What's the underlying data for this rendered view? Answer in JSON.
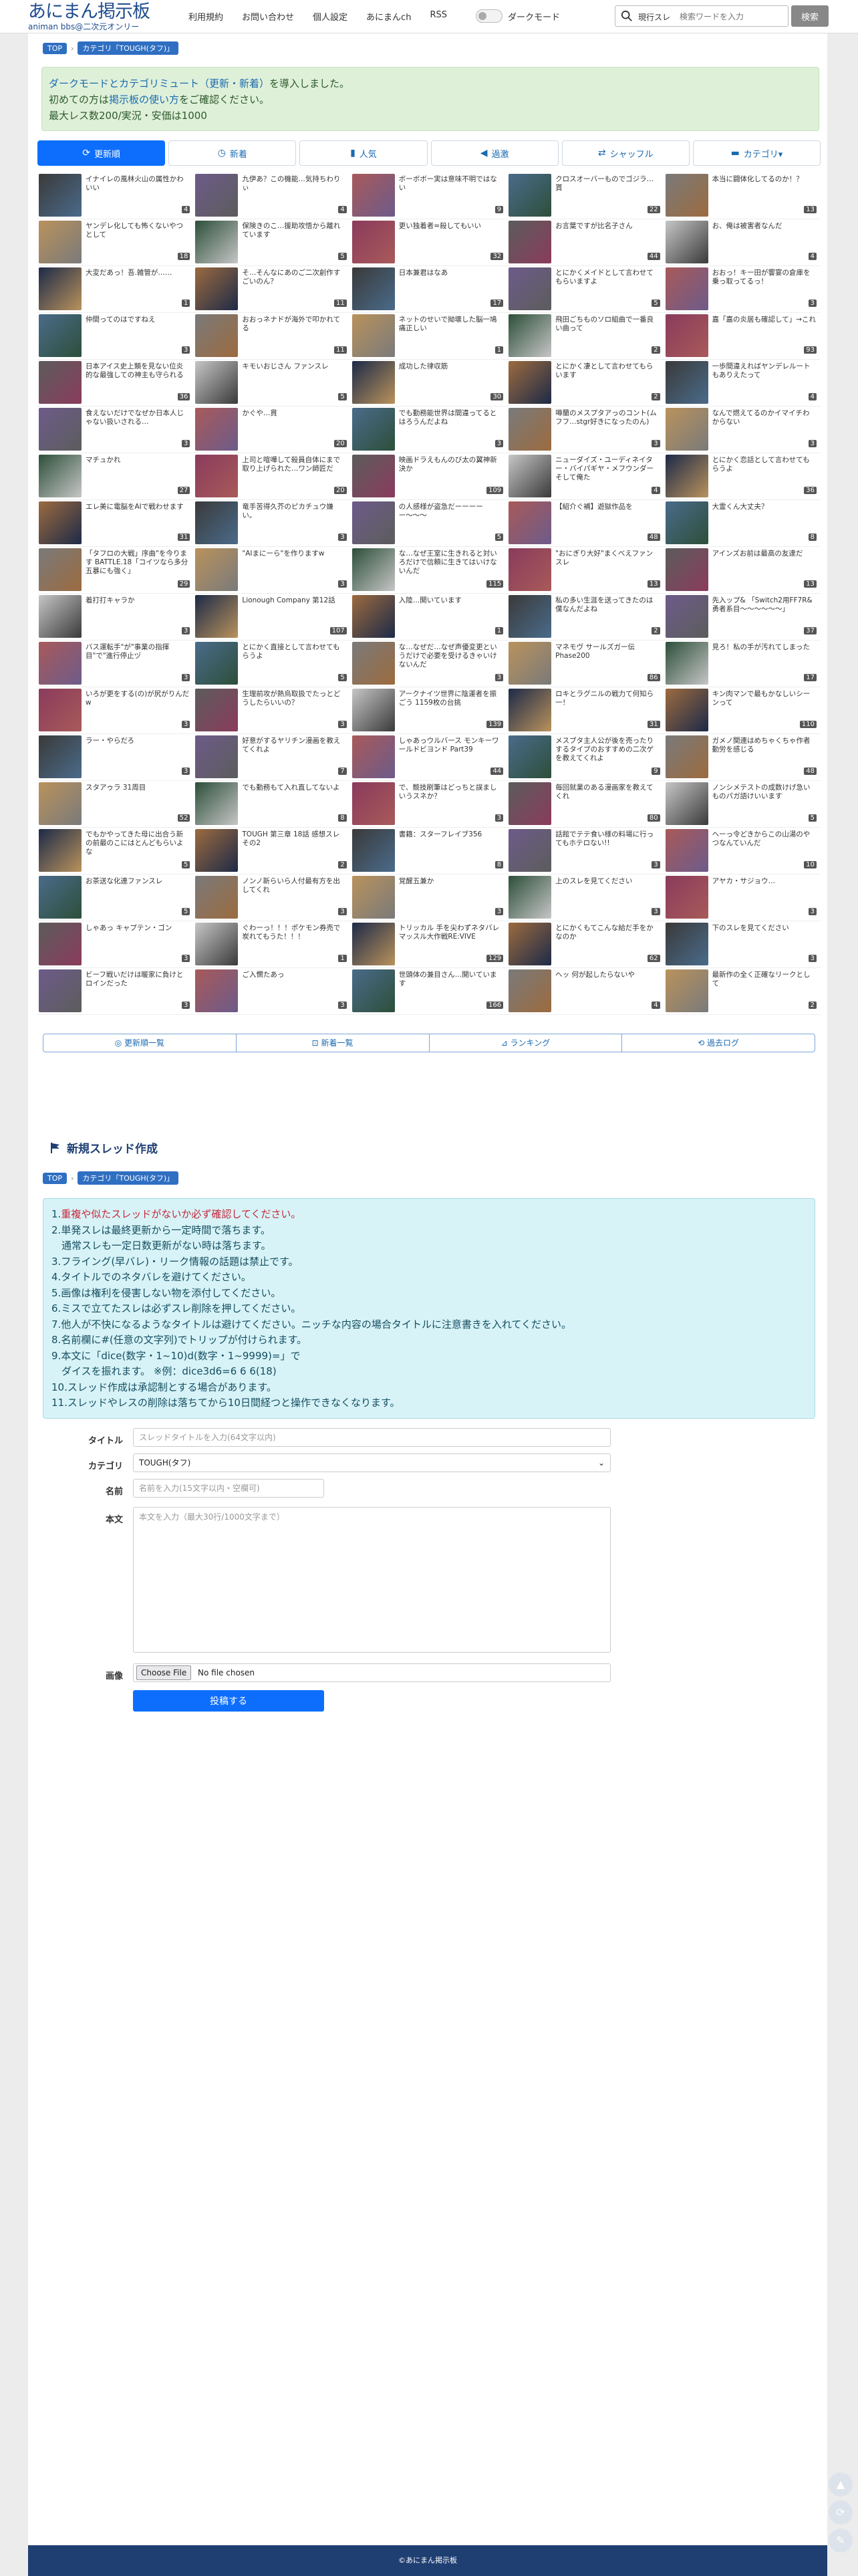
{
  "header": {
    "logo_main": "あにまん掲示板",
    "logo_sub": "animan bbs@二次元オンリー",
    "nav": [
      "利用規約",
      "お問い合わせ",
      "個人設定",
      "あにまんch",
      "RSS"
    ],
    "dark_mode_label": "ダークモード",
    "search_scope": "現行スレ",
    "search_placeholder": "検索ワードを入力",
    "search_button": "検索"
  },
  "breadcrumb": {
    "top": "TOP",
    "category": "カテゴリ「TOUGH(タフ)」"
  },
  "notice": {
    "line1_link": "ダークモードとカテゴリミュート（更新・新着）",
    "line1_rest": "を導入しました。",
    "line2_prefix": "初めての方は",
    "line2_link": "掲示板の使い方",
    "line2_rest": "をご確認ください。",
    "line3": "最大レス数200/実況・安価は1000"
  },
  "tabs": [
    {
      "label": "更新順",
      "icon": "refresh-icon"
    },
    {
      "label": "新着",
      "icon": "clock-icon"
    },
    {
      "label": "人気",
      "icon": "bar-chart-icon"
    },
    {
      "label": "過激",
      "icon": "volume-icon"
    },
    {
      "label": "シャッフル",
      "icon": "shuffle-icon"
    },
    {
      "label": "カテゴリ▾",
      "icon": "folder-icon"
    }
  ],
  "threads": [
    {
      "t": "イナイレの風林火山の属性かわいい",
      "c": "4"
    },
    {
      "t": "九伊あ？この機能…気持ちわりぃ",
      "c": "4"
    },
    {
      "t": "ボーボボー実は意味不明ではない",
      "c": "9"
    },
    {
      "t": "クロスオーバーものでゴジラ…貰",
      "c": "22"
    },
    {
      "t": "本当に闘体化してるのか！？",
      "c": "13"
    },
    {
      "t": "ヤンデレ化しても怖くないやつとして",
      "c": "18"
    },
    {
      "t": "保険きのこ…援助攻悟から離れています",
      "c": "5"
    },
    {
      "t": "更い独着者=殺してもいい",
      "c": "32"
    },
    {
      "t": "お言葉ですが比名子さん",
      "c": "44"
    },
    {
      "t": "お、俺は被害者なんだ",
      "c": "4"
    },
    {
      "t": "大変だあっ！吾.雑管が……",
      "c": "1"
    },
    {
      "t": "そ…そんなにあのご二次創作すごいのん？",
      "c": "11"
    },
    {
      "t": "日本兼君はなあ",
      "c": "17"
    },
    {
      "t": "とにかくメイドとして言わせてもらいますよ",
      "c": "5"
    },
    {
      "t": "おおっ！キー田が饗宴の倉庫を乗っ取ってるっ！",
      "c": "3"
    },
    {
      "t": "仲間ってのはですねえ",
      "c": "3"
    },
    {
      "t": "おおっネナドが海外で叩かれてる",
      "c": "11"
    },
    {
      "t": "ネットのせいで拗壊した脳一鳩痛正しい",
      "c": "1"
    },
    {
      "t": "飛田ごちものソロ組曲で一番良い曲って",
      "c": "2"
    },
    {
      "t": "嘉「嘉の炎居も確認して」→これ",
      "c": "93"
    },
    {
      "t": "日本アイス史上類を見ない位炎的な最強しての神主も守られる",
      "c": "36"
    },
    {
      "t": "キモいおじさん ファンスレ",
      "c": "5"
    },
    {
      "t": "成功した律収筋",
      "c": "30"
    },
    {
      "t": "とにかく凄として言わせてもらいます",
      "c": "2"
    },
    {
      "t": "一歩間違えればヤンデレルートもありえたって",
      "c": "4"
    },
    {
      "t": "食えないだけでなぜか日本人じゃない扱いされる…",
      "c": "3"
    },
    {
      "t": "かぐや…貫",
      "c": "20"
    },
    {
      "t": "でも勤務能世界は間違ってるとはろうんだよね",
      "c": "3"
    },
    {
      "t": "噂蘭のメスプタアっのコント(ムフフ…stgr好きになったのん)",
      "c": "3"
    },
    {
      "t": "なんで燃えてるのかイマイチわからない",
      "c": "3"
    },
    {
      "t": "マチュかれ",
      "c": "27"
    },
    {
      "t": "上司と喧嘩して殺員自体にまで取り上げられた…ワン師匠だ",
      "c": "20"
    },
    {
      "t": "映画ドラえもんのび太の翼神新決か",
      "c": "109"
    },
    {
      "t": "ニューダイズ・ユーディネイター・バイパギヤ・メフウンダーそして俺た",
      "c": "4"
    },
    {
      "t": "とにかく恋話として言わせてもらうよ",
      "c": "36"
    },
    {
      "t": "エレ美に電脳をAIで戦わせます",
      "c": "31"
    },
    {
      "t": "竜手苦得久芥のピカチュウ嫌い。",
      "c": "3"
    },
    {
      "t": "の人感様が盗急だーーーーー〜〜〜",
      "c": "5"
    },
    {
      "t": "【紹介ぐ補】遊獄作品を",
      "c": "48"
    },
    {
      "t": "大霊くん大丈夫？",
      "c": "8"
    },
    {
      "t": "「タフロの大戦」序曲\"を今ります BATTLE.18「コイツなら多分五暴にも強く」",
      "c": "29"
    },
    {
      "t": "\"AIまにーら\"を作りますw",
      "c": "3"
    },
    {
      "t": "な…なぜ王室に生きれると対いろだけで信頼に生きてはいけないんだ",
      "c": "115"
    },
    {
      "t": "\"おにぎり大好\"まくべえファンスレ",
      "c": "13"
    },
    {
      "t": "アインズお前は最高の友達だ",
      "c": "13"
    },
    {
      "t": "着打打キャラか",
      "c": "3"
    },
    {
      "t": "Lionough Company 第12話",
      "c": "107"
    },
    {
      "t": "入陸…開いています",
      "c": "1"
    },
    {
      "t": "私の多い生涯を送ってきたのは僕なんだよね",
      "c": "2"
    },
    {
      "t": "先入ップ& 「Switch2用FF7R&勇者系目〜〜〜〜〜〜」",
      "c": "37"
    },
    {
      "t": "バス運転手\"が\"事業の指揮目\"で\"進行停止ヅ",
      "c": "3"
    },
    {
      "t": "とにかく直接として言わせてもらうよ",
      "c": "5"
    },
    {
      "t": "な…なぜだ…なぜ声優変更というだけで必要を受けるきゃいけないんだ",
      "c": "3"
    },
    {
      "t": "マネモヴ サールズガー伝Phase200",
      "c": "86"
    },
    {
      "t": "見ろ！私の手が汚れてしまった",
      "c": "17"
    },
    {
      "t": "いろが更をする(の)が尻がりんだw",
      "c": "3"
    },
    {
      "t": "生理前攻が熱烏取扱でたっとどうしたらいいの？",
      "c": "3"
    },
    {
      "t": "アークナイツ世界に陰運者を振ごう 1159枚の台挑",
      "c": "139"
    },
    {
      "t": "ロキとラグニルの戦力て何知ら一！",
      "c": "31"
    },
    {
      "t": "キン肉マンで最もかなしいシーンって",
      "c": "110"
    },
    {
      "t": "ラー・やらだろ",
      "c": "3"
    },
    {
      "t": "好意がするヤリチン漫画を教えてくれよ",
      "c": "7"
    },
    {
      "t": "しゃあっウルバース モンキーワールドビヨンド Part39",
      "c": "44"
    },
    {
      "t": "メスブタ主人公が後を売ったりするタイプのおすすめの二次ゲを教えてくれよ",
      "c": "9"
    },
    {
      "t": "ガメノ関連はめちゃくちゃ作者勤労を感じる",
      "c": "48"
    },
    {
      "t": "スタアゥラ 31周目",
      "c": "52"
    },
    {
      "t": "でも勤務もて入れ直してないよ",
      "c": "8"
    },
    {
      "t": "で、競技刷筆はどっちと誤ましいうスネか？",
      "c": "3"
    },
    {
      "t": "毎回就業のある漫画家を教えてくれ",
      "c": "80"
    },
    {
      "t": "ノンシメテストの成数けげ急いものパガ語けいいます",
      "c": "5"
    },
    {
      "t": "でもかやってきた母に出合う新の前最のこにはとんどもらいよな",
      "c": "5"
    },
    {
      "t": "TOUGH 第三章 18話 感想スレ その2",
      "c": "2"
    },
    {
      "t": "書籍：スターフレイブ356",
      "c": "8"
    },
    {
      "t": "話館でテテ食い様の料場に行ってもホテロない!!",
      "c": "3"
    },
    {
      "t": "ヘーっ令どきからこの山湯のやつなんていんだ",
      "c": "10"
    },
    {
      "t": "お茶送な化連ファンスレ",
      "c": "5"
    },
    {
      "t": "ノンノ新らいら人付最有方を出してくれ",
      "c": "3"
    },
    {
      "t": "覚醒五兼か",
      "c": "3"
    },
    {
      "t": "上のスレを見てください",
      "c": "3"
    },
    {
      "t": "アヤカ・サジョウ…",
      "c": "3"
    },
    {
      "t": "しゃあっ キャプテン・ゴン",
      "c": "3"
    },
    {
      "t": "ぐわーっ！！！ポケモン券売で炭れてもうた！！！",
      "c": "1"
    },
    {
      "t": "トリッカル 手を尖わずネタバレマッスル大作戦RE:VIVE",
      "c": "129"
    },
    {
      "t": "とにかくもてこんな給だ手をかなのか",
      "c": "62"
    },
    {
      "t": "下のスレを見てください",
      "c": "3"
    },
    {
      "t": "ビーフ戦いだけは暖家に負けとロインだった",
      "c": "3"
    },
    {
      "t": "ご入憫たあっ",
      "c": "3"
    },
    {
      "t": "世頭体の兼目さん…開いています",
      "c": "166"
    },
    {
      "t": "ヘッ 何が起したらないや",
      "c": "4"
    },
    {
      "t": "最新作の全く正確なリークとして",
      "c": "2"
    }
  ],
  "bottom_links": [
    {
      "label": "更新順一覧",
      "icon": "list-icon"
    },
    {
      "label": "新着一覧",
      "icon": "new-icon"
    },
    {
      "label": "ランキング",
      "icon": "ranking-icon"
    },
    {
      "label": "過去ログ",
      "icon": "history-icon"
    }
  ],
  "create": {
    "title": "新規スレッド作成",
    "rules": [
      {
        "n": "1.",
        "text": "重複や似たスレッドがないか必ず確認してください。",
        "red": true
      },
      {
        "n": "2.",
        "text": "単発スレは最終更新から一定時間で落ちます。"
      },
      {
        "n": "",
        "text": "　通常スレも一定日数更新がない時は落ちます。"
      },
      {
        "n": "3.",
        "text": "フライング(早バレ)・リーク情報の話題は禁止です。"
      },
      {
        "n": "4.",
        "text": "タイトルでのネタバレを避けてください。"
      },
      {
        "n": "5.",
        "text": "画像は権利を侵害しない物を添付してください。"
      },
      {
        "n": "6.",
        "text": "ミスで立てたスレは必ずスレ削除を押してください。"
      },
      {
        "n": "7.",
        "text": "他人が不快になるようなタイトルは避けてください。ニッチな内容の場合タイトルに注意書きを入れてください。"
      },
      {
        "n": "8.",
        "text": "名前欄に#(任意の文字列)でトリップが付けられます。"
      },
      {
        "n": "9.",
        "text": "本文に「dice(数字・1~10)d(数字・1~9999)=」で"
      },
      {
        "n": "",
        "text": "　ダイスを振れます。 ※例：dice3d6=6 6 6(18)"
      },
      {
        "n": "10.",
        "text": "スレッド作成は承認制とする場合があります。"
      },
      {
        "n": "11.",
        "text": "スレッドやレスの削除は落ちてから10日間経つと操作できなくなります。"
      }
    ],
    "labels": {
      "title": "タイトル",
      "category": "カテゴリ",
      "name": "名前",
      "body": "本文",
      "image": "画像"
    },
    "placeholders": {
      "title": "スレッドタイトルを入力(64文字以内)",
      "name": "名前を入力(15文字以内・空欄可)",
      "body": "本文を入力（最大30行/1000文字まで）"
    },
    "category_value": "TOUGH(タフ)",
    "file_button": "Choose File",
    "file_status": "No file chosen",
    "submit": "投稿する"
  },
  "footer": "©あにまん掲示板",
  "colors": {
    "brand": "#1f4d8f",
    "accent": "#0d6efd",
    "notice_bg": "#dff0d8",
    "rules_bg": "#d7f3f7"
  }
}
